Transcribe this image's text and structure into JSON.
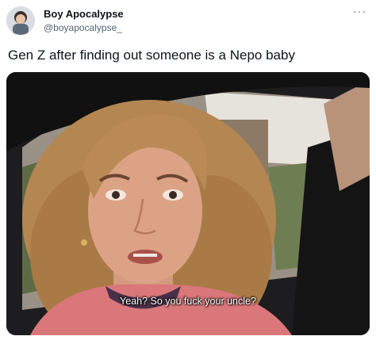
{
  "author": {
    "display_name": "Boy Apocalypse",
    "handle": "@boyapocalypse_",
    "avatar_icon": "avatar-image"
  },
  "menu": {
    "more_label": "···"
  },
  "tweet": {
    "text": "Gen Z after finding out someone is a Nepo baby"
  },
  "media": {
    "caption": "Yeah? So you fuck your uncle?"
  }
}
